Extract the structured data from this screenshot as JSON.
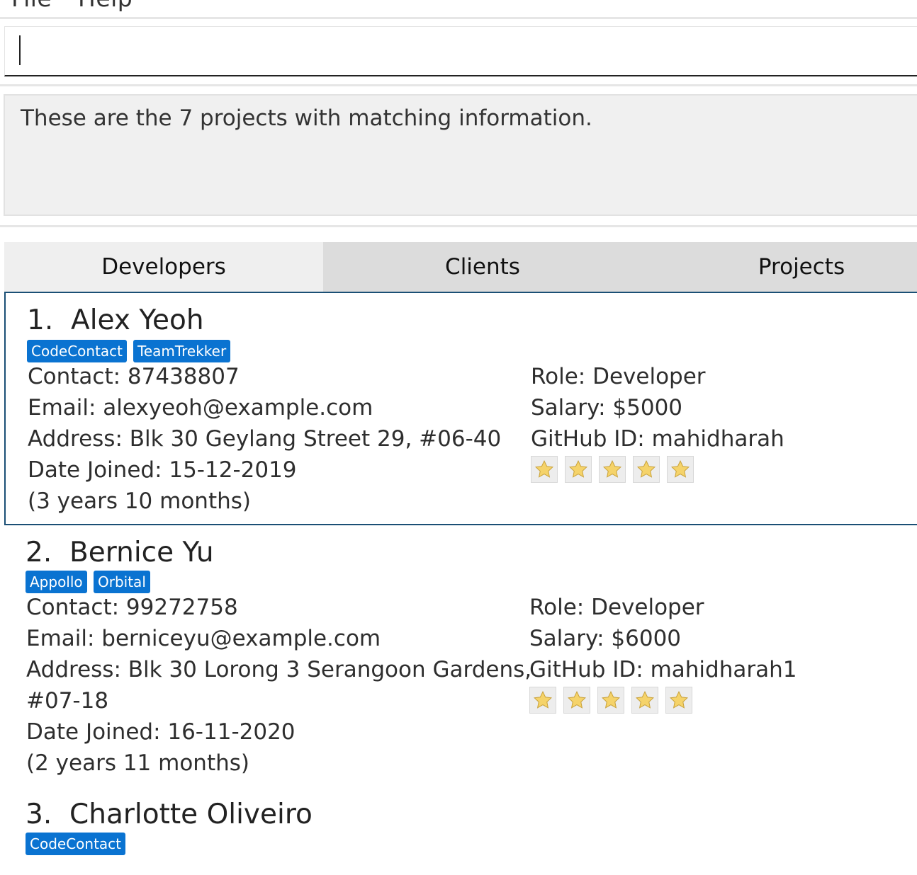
{
  "menu": {
    "file": "File",
    "help": "Help"
  },
  "command_box": {
    "value": ""
  },
  "result_display": {
    "text": "These are the 7 projects with matching information."
  },
  "tabs": [
    "Developers",
    "Clients",
    "Projects"
  ],
  "developers": [
    {
      "index": "1.",
      "name": "Alex Yeoh",
      "tags": [
        "CodeContact",
        "TeamTrekker"
      ],
      "contact": "Contact: 87438807",
      "email": "Email: alexyeoh@example.com",
      "address": "Address: Blk 30 Geylang Street 29, #06-40",
      "date_joined": "Date Joined: 15-12-2019",
      "tenure": "(3 years 10 months)",
      "role": "Role: Developer",
      "salary": "Salary: $5000",
      "github": "GitHub ID: mahidharah",
      "rating": 5,
      "selected": true
    },
    {
      "index": "2.",
      "name": "Bernice Yu",
      "tags": [
        "Appollo",
        "Orbital"
      ],
      "contact": "Contact: 99272758",
      "email": "Email: berniceyu@example.com",
      "address_line1": "Address: Blk 30 Lorong 3 Serangoon Gardens,",
      "address_line2": "#07-18",
      "date_joined": "Date Joined: 16-11-2020",
      "tenure": "(2 years 11 months)",
      "role": "Role: Developer",
      "salary": "Salary: $6000",
      "github": "GitHub ID: mahidharah1",
      "rating": 5,
      "selected": false
    },
    {
      "index": "3.",
      "name": "Charlotte Oliveiro",
      "tags": [
        "CodeContact"
      ]
    }
  ],
  "colors": {
    "tag_bg": "#0a73d1",
    "selected_border": "#1a4f75",
    "star": "#f5d36a"
  },
  "icons": {
    "rating": "star-icon"
  }
}
